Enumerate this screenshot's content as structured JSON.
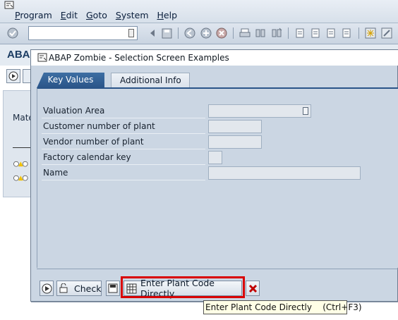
{
  "menubar": {
    "items": [
      {
        "label": "Program",
        "ul": "P",
        "rest": "rogram"
      },
      {
        "label": "Edit",
        "ul": "E",
        "rest": "dit"
      },
      {
        "label": "Goto",
        "ul": "G",
        "rest": "oto"
      },
      {
        "label": "System",
        "ul": "S",
        "rest": "ystem"
      },
      {
        "label": "Help",
        "ul": "H",
        "rest": "elp"
      }
    ]
  },
  "toolbar": {
    "command_value": ""
  },
  "background": {
    "app_title": "ABA",
    "partial_label": "Mate"
  },
  "dialog": {
    "title": "ABAP Zombie - Selection Screen Examples",
    "tabs": [
      "Key Values",
      "Additional Info"
    ],
    "fields": [
      {
        "label": "Valuation Area",
        "value": ""
      },
      {
        "label": "Customer number of plant",
        "value": ""
      },
      {
        "label": "Vendor number of plant",
        "value": ""
      },
      {
        "label": "Factory calendar key",
        "value": ""
      },
      {
        "label": "Name",
        "value": ""
      }
    ],
    "buttons": {
      "check": "Check",
      "enter_plant": "Enter Plant Code Directly"
    }
  },
  "tooltip": "Enter Plant Code Directly    (Ctrl+F3)",
  "colors": {
    "highlight": "#d90000",
    "tab_active": "#2a5488",
    "dialog_bg": "#cbd6e3"
  }
}
